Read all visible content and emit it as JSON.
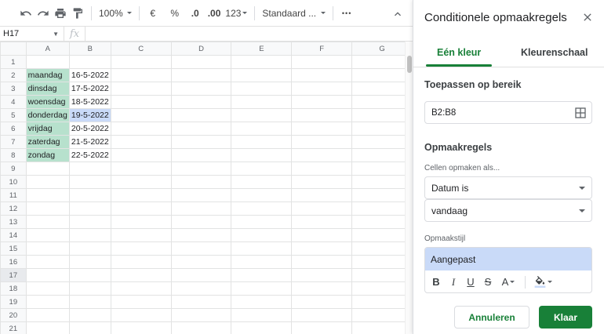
{
  "toolbar": {
    "zoom": "100%",
    "currency": "€",
    "percent": "%",
    "decrease_decimals": ".0",
    "increase_decimals": ".00",
    "more_formats": "123",
    "font": "Standaard ...",
    "more": "•••"
  },
  "formula_bar": {
    "cell_ref": "H17",
    "fx": "fx"
  },
  "sheet": {
    "columns": [
      "A",
      "B",
      "C",
      "D",
      "E",
      "F",
      "G"
    ],
    "rows": [
      {
        "num": "1",
        "a": "",
        "b": ""
      },
      {
        "num": "2",
        "a": "maandag",
        "b": "16-5-2022"
      },
      {
        "num": "3",
        "a": "dinsdag",
        "b": "17-5-2022"
      },
      {
        "num": "4",
        "a": "woensdag",
        "b": "18-5-2022"
      },
      {
        "num": "5",
        "a": "donderdag",
        "b": "19-5-2022"
      },
      {
        "num": "6",
        "a": "vrijdag",
        "b": "20-5-2022"
      },
      {
        "num": "7",
        "a": "zaterdag",
        "b": "21-5-2022"
      },
      {
        "num": "8",
        "a": "zondag",
        "b": "22-5-2022"
      },
      {
        "num": "9",
        "a": "",
        "b": ""
      },
      {
        "num": "10",
        "a": "",
        "b": ""
      },
      {
        "num": "11",
        "a": "",
        "b": ""
      },
      {
        "num": "12",
        "a": "",
        "b": ""
      },
      {
        "num": "13",
        "a": "",
        "b": ""
      },
      {
        "num": "14",
        "a": "",
        "b": ""
      },
      {
        "num": "15",
        "a": "",
        "b": ""
      },
      {
        "num": "16",
        "a": "",
        "b": ""
      },
      {
        "num": "17",
        "a": "",
        "b": ""
      },
      {
        "num": "18",
        "a": "",
        "b": ""
      },
      {
        "num": "19",
        "a": "",
        "b": ""
      },
      {
        "num": "20",
        "a": "",
        "b": ""
      },
      {
        "num": "21",
        "a": "",
        "b": ""
      }
    ],
    "highlight_colors": {
      "green": "#b7e1cd",
      "blue": "#c9daf8"
    },
    "highlighted_today_row": "5",
    "selected_row": "17"
  },
  "panel": {
    "title": "Conditionele opmaakregels",
    "tab_single": "Eén kleur",
    "tab_scale": "Kleurenschaal",
    "range_label": "Toepassen op bereik",
    "range_value": "B2:B8",
    "rules_label": "Opmaakregels",
    "format_cells_label": "Cellen opmaken als...",
    "condition": "Datum is",
    "condition_value": "vandaag",
    "style_label": "Opmaakstijl",
    "style_preview": "Aangepast",
    "style_bold": "B",
    "style_italic": "I",
    "style_underline": "U",
    "style_strike": "S",
    "style_text_color": "A",
    "cancel": "Annuleren",
    "done": "Klaar",
    "accent_color": "#188038",
    "preview_fill": "#c9daf8"
  }
}
